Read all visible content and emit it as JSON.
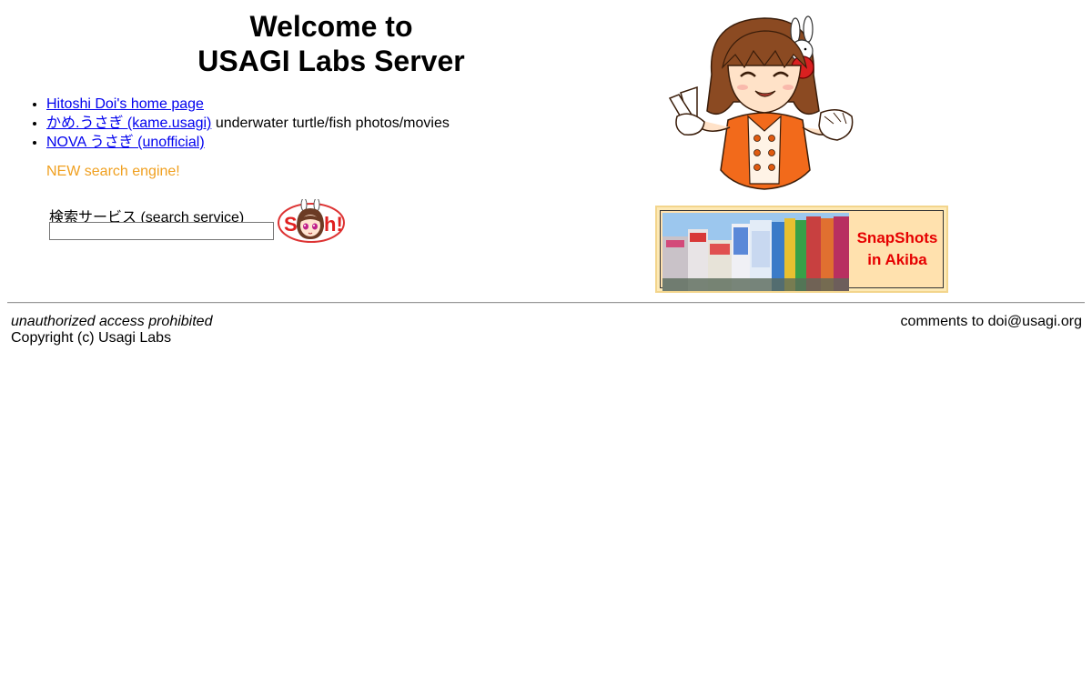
{
  "header": {
    "title_line1": "Welcome to",
    "title_line2": "USAGI Labs Server"
  },
  "links": [
    {
      "label": "Hitoshi Doi's home page",
      "description": ""
    },
    {
      "label": "かめ.うさぎ (kame.usagi)",
      "description": " underwater turtle/fish photos/movies"
    },
    {
      "label": "NOVA うさぎ (unofficial)",
      "description": ""
    }
  ],
  "new_notice": "NEW search engine!",
  "search": {
    "label": "検索サービス (search service)",
    "value": "",
    "button_icon": "search-bunny-girl-icon"
  },
  "mascot": {
    "icon": "bunny-girl-peace-sign-illustration"
  },
  "banner": {
    "line1": "SnapShots",
    "line2": "in Akiba",
    "text_color": "#e60000",
    "background": "#ffe1ae"
  },
  "footer": {
    "warning": "unauthorized access prohibited",
    "copyright": "Copyright (c) Usagi Labs",
    "contact": "comments to doi@usagi.org"
  },
  "colors": {
    "link": "#0000ee",
    "new_notice": "#f0a020"
  }
}
